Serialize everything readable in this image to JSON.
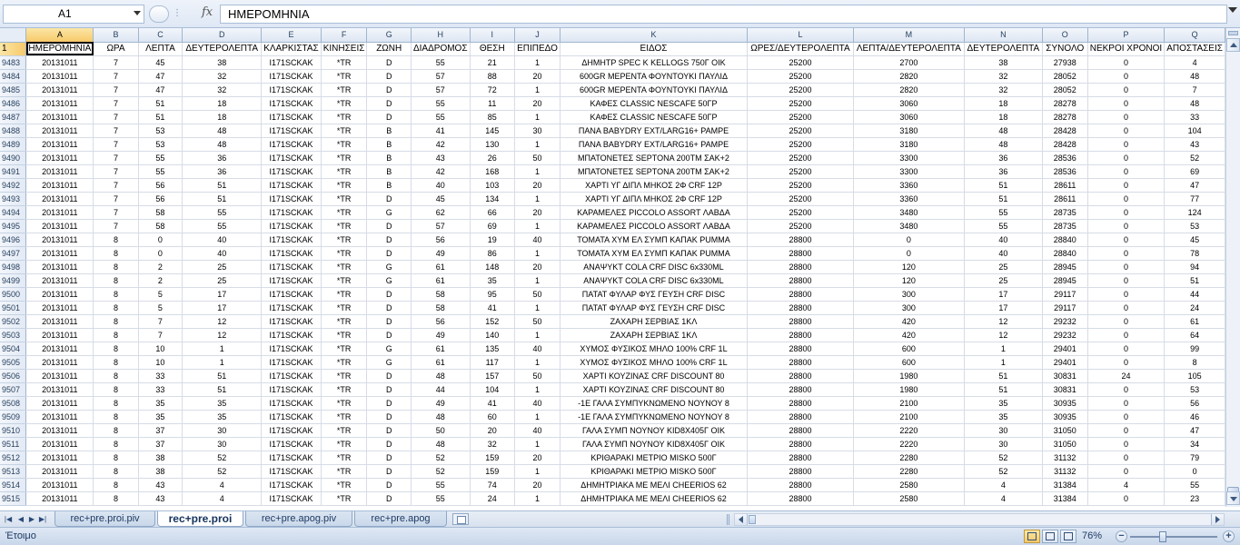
{
  "formula_bar": {
    "name_box": "A1",
    "formula": "ΗΜΕΡΟΜΗΝΙΑ",
    "fx_label": "fx"
  },
  "grid": {
    "columns": [
      "A",
      "B",
      "C",
      "D",
      "E",
      "F",
      "G",
      "H",
      "I",
      "J",
      "K",
      "L",
      "M",
      "N",
      "O",
      "P",
      "Q"
    ],
    "active_column": "A",
    "active_row": "1",
    "header_row": {
      "row_number": "1",
      "cells": [
        "ΗΜΕΡΟΜΗΝΙΑ",
        "ΩΡΑ",
        "ΛΕΠΤΑ",
        "ΔΕΥΤΕΡΟΛΕΠΤΑ",
        "ΚΛΑΡΚΙΣΤΑΣ",
        "ΚΙΝΗΣΕΙΣ",
        "ΖΩΝΗ",
        "ΔΙΑΔΡΟΜΟΣ",
        "ΘΕΣΗ",
        "ΕΠΙΠΕΔΟ",
        "ΕΙΔΟΣ",
        "ΩΡΕΣ/ΔΕΥΤΕΡΟΛΕΠΤΑ",
        "ΛΕΠΤΑ/ΔΕΥΤΕΡΟΛΕΠΤΑ",
        "ΔΕΥΤΕΡΟΛΕΠΤΑ",
        "ΣΥΝΟΛΟ",
        "ΝΕΚΡΟΙ ΧΡΟΝΟΙ",
        "ΑΠΟΣΤΑΣΕΙΣ"
      ]
    },
    "rows": [
      {
        "n": "9483",
        "cells": [
          "20131011",
          "7",
          "45",
          "38",
          "I171SCKAK",
          "*TR",
          "D",
          "55",
          "21",
          "1",
          "ΔΗΜΗΤΡ SPEC K KELLOGS 750Γ ΟΙΚ",
          "25200",
          "2700",
          "38",
          "27938",
          "0",
          "4"
        ]
      },
      {
        "n": "9484",
        "cells": [
          "20131011",
          "7",
          "47",
          "32",
          "I171SCKAK",
          "*TR",
          "D",
          "57",
          "88",
          "20",
          "600GR ΜΕΡΕΝΤΑ ΦΟΥΝΤΟΥΚΙ ΠΑΥΛΙΔ",
          "25200",
          "2820",
          "32",
          "28052",
          "0",
          "48"
        ]
      },
      {
        "n": "9485",
        "cells": [
          "20131011",
          "7",
          "47",
          "32",
          "I171SCKAK",
          "*TR",
          "D",
          "57",
          "72",
          "1",
          "600GR ΜΕΡΕΝΤΑ ΦΟΥΝΤΟΥΚΙ ΠΑΥΛΙΔ",
          "25200",
          "2820",
          "32",
          "28052",
          "0",
          "7"
        ]
      },
      {
        "n": "9486",
        "cells": [
          "20131011",
          "7",
          "51",
          "18",
          "I171SCKAK",
          "*TR",
          "D",
          "55",
          "11",
          "20",
          "ΚΑΦΕΣ CLASSIC NESCAFE 50ΓΡ",
          "25200",
          "3060",
          "18",
          "28278",
          "0",
          "48"
        ]
      },
      {
        "n": "9487",
        "cells": [
          "20131011",
          "7",
          "51",
          "18",
          "I171SCKAK",
          "*TR",
          "D",
          "55",
          "85",
          "1",
          "ΚΑΦΕΣ CLASSIC NESCAFE 50ΓΡ",
          "25200",
          "3060",
          "18",
          "28278",
          "0",
          "33"
        ]
      },
      {
        "n": "9488",
        "cells": [
          "20131011",
          "7",
          "53",
          "48",
          "I171SCKAK",
          "*TR",
          "B",
          "41",
          "145",
          "30",
          "ΠΑΝΑ BABYDRY EXT/LARG16+ PAMPE",
          "25200",
          "3180",
          "48",
          "28428",
          "0",
          "104"
        ]
      },
      {
        "n": "9489",
        "cells": [
          "20131011",
          "7",
          "53",
          "48",
          "I171SCKAK",
          "*TR",
          "B",
          "42",
          "130",
          "1",
          "ΠΑΝΑ BABYDRY EXT/LARG16+ PAMPE",
          "25200",
          "3180",
          "48",
          "28428",
          "0",
          "43"
        ]
      },
      {
        "n": "9490",
        "cells": [
          "20131011",
          "7",
          "55",
          "36",
          "I171SCKAK",
          "*TR",
          "B",
          "43",
          "26",
          "50",
          "ΜΠΑΤΟΝΕΤΕΣ SEPTONA 200TM ΣΑΚ+2",
          "25200",
          "3300",
          "36",
          "28536",
          "0",
          "52"
        ]
      },
      {
        "n": "9491",
        "cells": [
          "20131011",
          "7",
          "55",
          "36",
          "I171SCKAK",
          "*TR",
          "B",
          "42",
          "168",
          "1",
          "ΜΠΑΤΟΝΕΤΕΣ SEPTONA 200TM ΣΑΚ+2",
          "25200",
          "3300",
          "36",
          "28536",
          "0",
          "69"
        ]
      },
      {
        "n": "9492",
        "cells": [
          "20131011",
          "7",
          "56",
          "51",
          "I171SCKAK",
          "*TR",
          "B",
          "40",
          "103",
          "20",
          "ΧΑΡΤΙ ΥΓ ΔΙΠΛ ΜΗΚΟΣ 2Φ CRF 12P",
          "25200",
          "3360",
          "51",
          "28611",
          "0",
          "47"
        ]
      },
      {
        "n": "9493",
        "cells": [
          "20131011",
          "7",
          "56",
          "51",
          "I171SCKAK",
          "*TR",
          "D",
          "45",
          "134",
          "1",
          "ΧΑΡΤΙ ΥΓ ΔΙΠΛ ΜΗΚΟΣ 2Φ CRF 12P",
          "25200",
          "3360",
          "51",
          "28611",
          "0",
          "77"
        ]
      },
      {
        "n": "9494",
        "cells": [
          "20131011",
          "7",
          "58",
          "55",
          "I171SCKAK",
          "*TR",
          "G",
          "62",
          "66",
          "20",
          "ΚΑΡΑΜΕΛΕΣ PICCOLO ASSORT ΛΑΒΔΑ",
          "25200",
          "3480",
          "55",
          "28735",
          "0",
          "124"
        ]
      },
      {
        "n": "9495",
        "cells": [
          "20131011",
          "7",
          "58",
          "55",
          "I171SCKAK",
          "*TR",
          "D",
          "57",
          "69",
          "1",
          "ΚΑΡΑΜΕΛΕΣ PICCOLO ASSORT ΛΑΒΔΑ",
          "25200",
          "3480",
          "55",
          "28735",
          "0",
          "53"
        ]
      },
      {
        "n": "9496",
        "cells": [
          "20131011",
          "8",
          "0",
          "40",
          "I171SCKAK",
          "*TR",
          "D",
          "56",
          "19",
          "40",
          "ΤΟΜΑΤΑ ΧΥΜ ΕΛ ΣΥΜΠ ΚΑΠΑΚ PUMMA",
          "28800",
          "0",
          "40",
          "28840",
          "0",
          "45"
        ]
      },
      {
        "n": "9497",
        "cells": [
          "20131011",
          "8",
          "0",
          "40",
          "I171SCKAK",
          "*TR",
          "D",
          "49",
          "86",
          "1",
          "ΤΟΜΑΤΑ ΧΥΜ ΕΛ ΣΥΜΠ ΚΑΠΑΚ PUMMA",
          "28800",
          "0",
          "40",
          "28840",
          "0",
          "78"
        ]
      },
      {
        "n": "9498",
        "cells": [
          "20131011",
          "8",
          "2",
          "25",
          "I171SCKAK",
          "*TR",
          "G",
          "61",
          "148",
          "20",
          "ΑΝΑΨΥΚΤ COLA CRF DISC 6x330ML",
          "28800",
          "120",
          "25",
          "28945",
          "0",
          "94"
        ]
      },
      {
        "n": "9499",
        "cells": [
          "20131011",
          "8",
          "2",
          "25",
          "I171SCKAK",
          "*TR",
          "G",
          "61",
          "35",
          "1",
          "ΑΝΑΨΥΚΤ COLA CRF DISC 6x330ML",
          "28800",
          "120",
          "25",
          "28945",
          "0",
          "51"
        ]
      },
      {
        "n": "9500",
        "cells": [
          "20131011",
          "8",
          "5",
          "17",
          "I171SCKAK",
          "*TR",
          "D",
          "58",
          "95",
          "50",
          "ΠΑΤΑΤ ΦΥΛΑΡ ΦΥΣ ΓΕΥΣΗ CRF DISC",
          "28800",
          "300",
          "17",
          "29117",
          "0",
          "44"
        ]
      },
      {
        "n": "9501",
        "cells": [
          "20131011",
          "8",
          "5",
          "17",
          "I171SCKAK",
          "*TR",
          "D",
          "58",
          "41",
          "1",
          "ΠΑΤΑΤ ΦΥΛΑΡ ΦΥΣ ΓΕΥΣΗ CRF DISC",
          "28800",
          "300",
          "17",
          "29117",
          "0",
          "24"
        ]
      },
      {
        "n": "9502",
        "cells": [
          "20131011",
          "8",
          "7",
          "12",
          "I171SCKAK",
          "*TR",
          "D",
          "56",
          "152",
          "50",
          "ΖΑΧΑΡΗ ΣΕΡΒΙΑΣ 1ΚΛ",
          "28800",
          "420",
          "12",
          "29232",
          "0",
          "61"
        ]
      },
      {
        "n": "9503",
        "cells": [
          "20131011",
          "8",
          "7",
          "12",
          "I171SCKAK",
          "*TR",
          "D",
          "49",
          "140",
          "1",
          "ΖΑΧΑΡΗ ΣΕΡΒΙΑΣ 1ΚΛ",
          "28800",
          "420",
          "12",
          "29232",
          "0",
          "64"
        ]
      },
      {
        "n": "9504",
        "cells": [
          "20131011",
          "8",
          "10",
          "1",
          "I171SCKAK",
          "*TR",
          "G",
          "61",
          "135",
          "40",
          "ΧΥΜΟΣ ΦΥΣΙΚΟΣ ΜΗΛΟ 100% CRF 1L",
          "28800",
          "600",
          "1",
          "29401",
          "0",
          "99"
        ]
      },
      {
        "n": "9505",
        "cells": [
          "20131011",
          "8",
          "10",
          "1",
          "I171SCKAK",
          "*TR",
          "G",
          "61",
          "117",
          "1",
          "ΧΥΜΟΣ ΦΥΣΙΚΟΣ ΜΗΛΟ 100% CRF 1L",
          "28800",
          "600",
          "1",
          "29401",
          "0",
          "8"
        ]
      },
      {
        "n": "9506",
        "cells": [
          "20131011",
          "8",
          "33",
          "51",
          "I171SCKAK",
          "*TR",
          "D",
          "48",
          "157",
          "50",
          "ΧΑΡΤΙ ΚΟΥΖΙΝΑΣ CRF DISCOUNT 80",
          "28800",
          "1980",
          "51",
          "30831",
          "24",
          "105"
        ]
      },
      {
        "n": "9507",
        "cells": [
          "20131011",
          "8",
          "33",
          "51",
          "I171SCKAK",
          "*TR",
          "D",
          "44",
          "104",
          "1",
          "ΧΑΡΤΙ ΚΟΥΖΙΝΑΣ CRF DISCOUNT 80",
          "28800",
          "1980",
          "51",
          "30831",
          "0",
          "53"
        ]
      },
      {
        "n": "9508",
        "cells": [
          "20131011",
          "8",
          "35",
          "35",
          "I171SCKAK",
          "*TR",
          "D",
          "49",
          "41",
          "40",
          "-1Ε ΓΑΛΑ ΣΥΜΠΥΚΝΩΜΕΝΟ ΝΟΥΝΟΥ 8",
          "28800",
          "2100",
          "35",
          "30935",
          "0",
          "56"
        ]
      },
      {
        "n": "9509",
        "cells": [
          "20131011",
          "8",
          "35",
          "35",
          "I171SCKAK",
          "*TR",
          "D",
          "48",
          "60",
          "1",
          "-1Ε ΓΑΛΑ ΣΥΜΠΥΚΝΩΜΕΝΟ ΝΟΥΝΟΥ 8",
          "28800",
          "2100",
          "35",
          "30935",
          "0",
          "46"
        ]
      },
      {
        "n": "9510",
        "cells": [
          "20131011",
          "8",
          "37",
          "30",
          "I171SCKAK",
          "*TR",
          "D",
          "50",
          "20",
          "40",
          "ΓΑΛΑ ΣΥΜΠ ΝΟΥΝΟΥ KID8X405Γ ΟΙΚ",
          "28800",
          "2220",
          "30",
          "31050",
          "0",
          "47"
        ]
      },
      {
        "n": "9511",
        "cells": [
          "20131011",
          "8",
          "37",
          "30",
          "I171SCKAK",
          "*TR",
          "D",
          "48",
          "32",
          "1",
          "ΓΑΛΑ ΣΥΜΠ ΝΟΥΝΟΥ KID8X405Γ ΟΙΚ",
          "28800",
          "2220",
          "30",
          "31050",
          "0",
          "34"
        ]
      },
      {
        "n": "9512",
        "cells": [
          "20131011",
          "8",
          "38",
          "52",
          "I171SCKAK",
          "*TR",
          "D",
          "52",
          "159",
          "20",
          "ΚΡΙΘΑΡΑΚΙ ΜΕΤΡΙΟ MISKO 500Γ",
          "28800",
          "2280",
          "52",
          "31132",
          "0",
          "79"
        ]
      },
      {
        "n": "9513",
        "cells": [
          "20131011",
          "8",
          "38",
          "52",
          "I171SCKAK",
          "*TR",
          "D",
          "52",
          "159",
          "1",
          "ΚΡΙΘΑΡΑΚΙ ΜΕΤΡΙΟ MISKO 500Γ",
          "28800",
          "2280",
          "52",
          "31132",
          "0",
          "0"
        ]
      },
      {
        "n": "9514",
        "cells": [
          "20131011",
          "8",
          "43",
          "4",
          "I171SCKAK",
          "*TR",
          "D",
          "55",
          "74",
          "20",
          "ΔΗΜΗΤΡΙΑΚΑ ΜΕ ΜΕΛΙ CHEERIOS 62",
          "28800",
          "2580",
          "4",
          "31384",
          "4",
          "55"
        ]
      },
      {
        "n": "9515",
        "cells": [
          "20131011",
          "8",
          "43",
          "4",
          "I171SCKAK",
          "*TR",
          "D",
          "55",
          "24",
          "1",
          "ΔΗΜΗΤΡΙΑΚΑ ΜΕ ΜΕΛΙ CHEERIOS 62",
          "28800",
          "2580",
          "4",
          "31384",
          "0",
          "23"
        ]
      }
    ]
  },
  "sheet_tabs": [
    {
      "label": "rec+pre.proi.piv",
      "active": false
    },
    {
      "label": "rec+pre.proi",
      "active": true
    },
    {
      "label": "rec+pre.apog.piv",
      "active": false
    },
    {
      "label": "rec+pre.apog",
      "active": false
    }
  ],
  "status_bar": {
    "status": "Έτοιμο",
    "zoom": "76%",
    "zoom_out": "−",
    "zoom_in": "+"
  },
  "colors": {
    "header_bg": "#dde6f3",
    "active_header": "#f7c96a",
    "gridline": "#d6dce6"
  }
}
